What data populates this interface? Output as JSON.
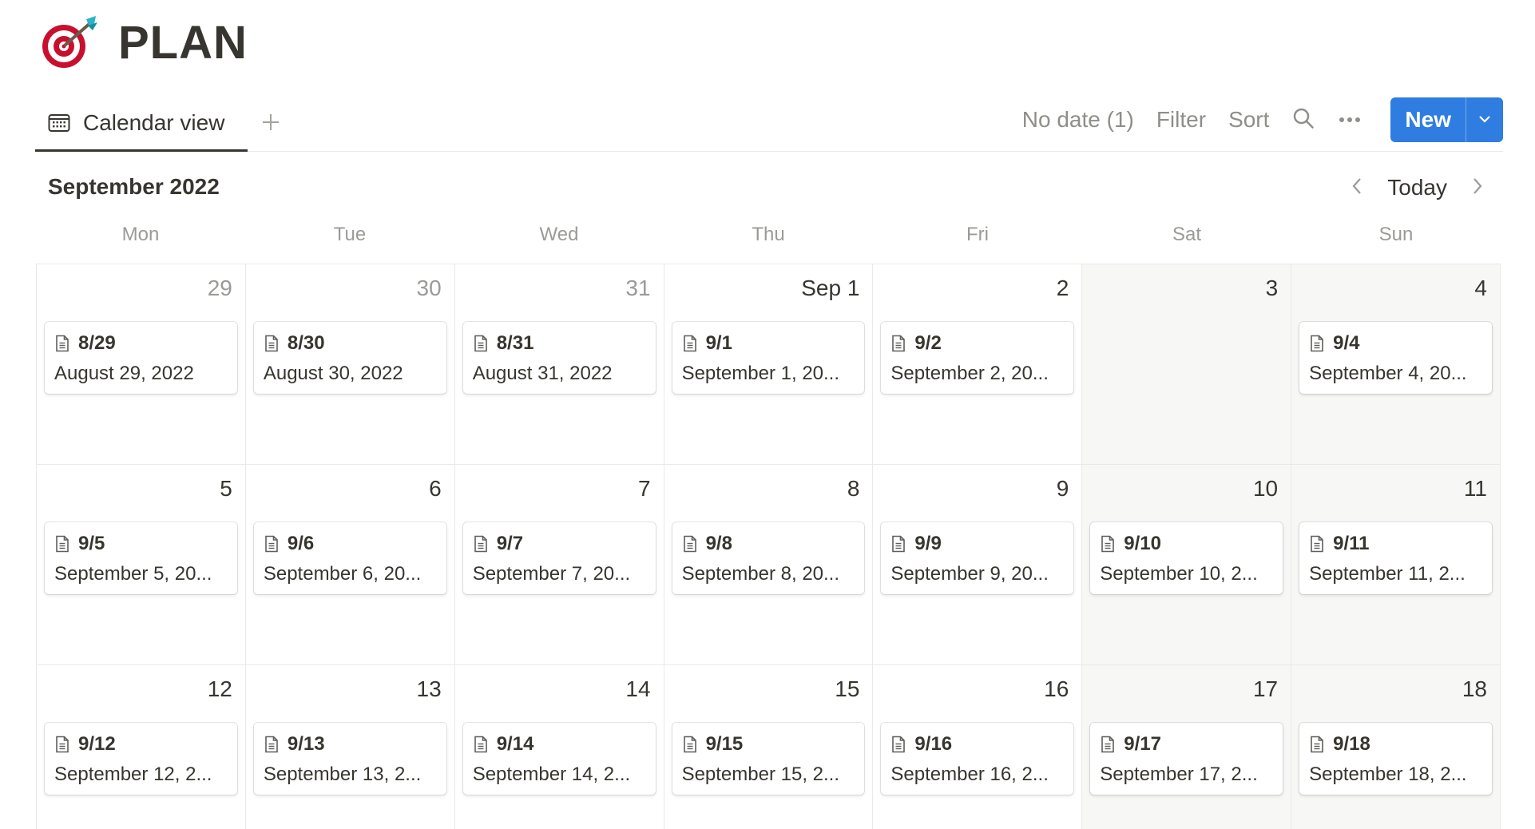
{
  "page": {
    "icon": "target-dart-icon",
    "title": "PLAN"
  },
  "toolbar": {
    "view_tab_label": "Calendar view",
    "no_date_label": "No date (1)",
    "filter_label": "Filter",
    "sort_label": "Sort",
    "new_label": "New",
    "icons": [
      "calendar-icon",
      "plus-icon",
      "search-icon",
      "more-icon",
      "chevron-down-icon"
    ]
  },
  "calendar": {
    "month_label": "September 2022",
    "today_label": "Today",
    "weekdays": [
      "Mon",
      "Tue",
      "Wed",
      "Thu",
      "Fri",
      "Sat",
      "Sun"
    ],
    "weeks": [
      [
        {
          "day": "29",
          "muted": true,
          "event": {
            "title": "8/29",
            "date": "August 29, 2022"
          }
        },
        {
          "day": "30",
          "muted": true,
          "event": {
            "title": "8/30",
            "date": "August 30, 2022"
          }
        },
        {
          "day": "31",
          "muted": true,
          "event": {
            "title": "8/31",
            "date": "August 31, 2022"
          }
        },
        {
          "day": "Sep 1",
          "event": {
            "title": "9/1",
            "date": "September 1, 20..."
          }
        },
        {
          "day": "2",
          "event": {
            "title": "9/2",
            "date": "September 2, 20..."
          }
        },
        {
          "day": "3",
          "weekend": true
        },
        {
          "day": "4",
          "weekend": true,
          "event": {
            "title": "9/4",
            "date": "September 4, 20..."
          }
        }
      ],
      [
        {
          "day": "5",
          "event": {
            "title": "9/5",
            "date": "September 5, 20..."
          }
        },
        {
          "day": "6",
          "event": {
            "title": "9/6",
            "date": "September 6, 20..."
          }
        },
        {
          "day": "7",
          "event": {
            "title": "9/7",
            "date": "September 7, 20..."
          }
        },
        {
          "day": "8",
          "event": {
            "title": "9/8",
            "date": "September 8, 20..."
          }
        },
        {
          "day": "9",
          "event": {
            "title": "9/9",
            "date": "September 9, 20..."
          }
        },
        {
          "day": "10",
          "weekend": true,
          "event": {
            "title": "9/10",
            "date": "September 10, 2..."
          }
        },
        {
          "day": "11",
          "weekend": true,
          "event": {
            "title": "9/11",
            "date": "September 11, 2..."
          }
        }
      ],
      [
        {
          "day": "12",
          "event": {
            "title": "9/12",
            "date": "September 12, 2..."
          }
        },
        {
          "day": "13",
          "event": {
            "title": "9/13",
            "date": "September 13, 2..."
          }
        },
        {
          "day": "14",
          "event": {
            "title": "9/14",
            "date": "September 14, 2..."
          }
        },
        {
          "day": "15",
          "event": {
            "title": "9/15",
            "date": "September 15, 2..."
          }
        },
        {
          "day": "16",
          "event": {
            "title": "9/16",
            "date": "September 16, 2..."
          }
        },
        {
          "day": "17",
          "weekend": true,
          "event": {
            "title": "9/17",
            "date": "September 17, 2..."
          }
        },
        {
          "day": "18",
          "weekend": true,
          "event": {
            "title": "9/18",
            "date": "September 18, 2..."
          }
        }
      ]
    ]
  },
  "colors": {
    "accent": "#2f7de1",
    "text": "#37352f",
    "muted": "#9b9a97",
    "weekend_bg": "#f7f7f5",
    "border": "#e9e9e7"
  }
}
